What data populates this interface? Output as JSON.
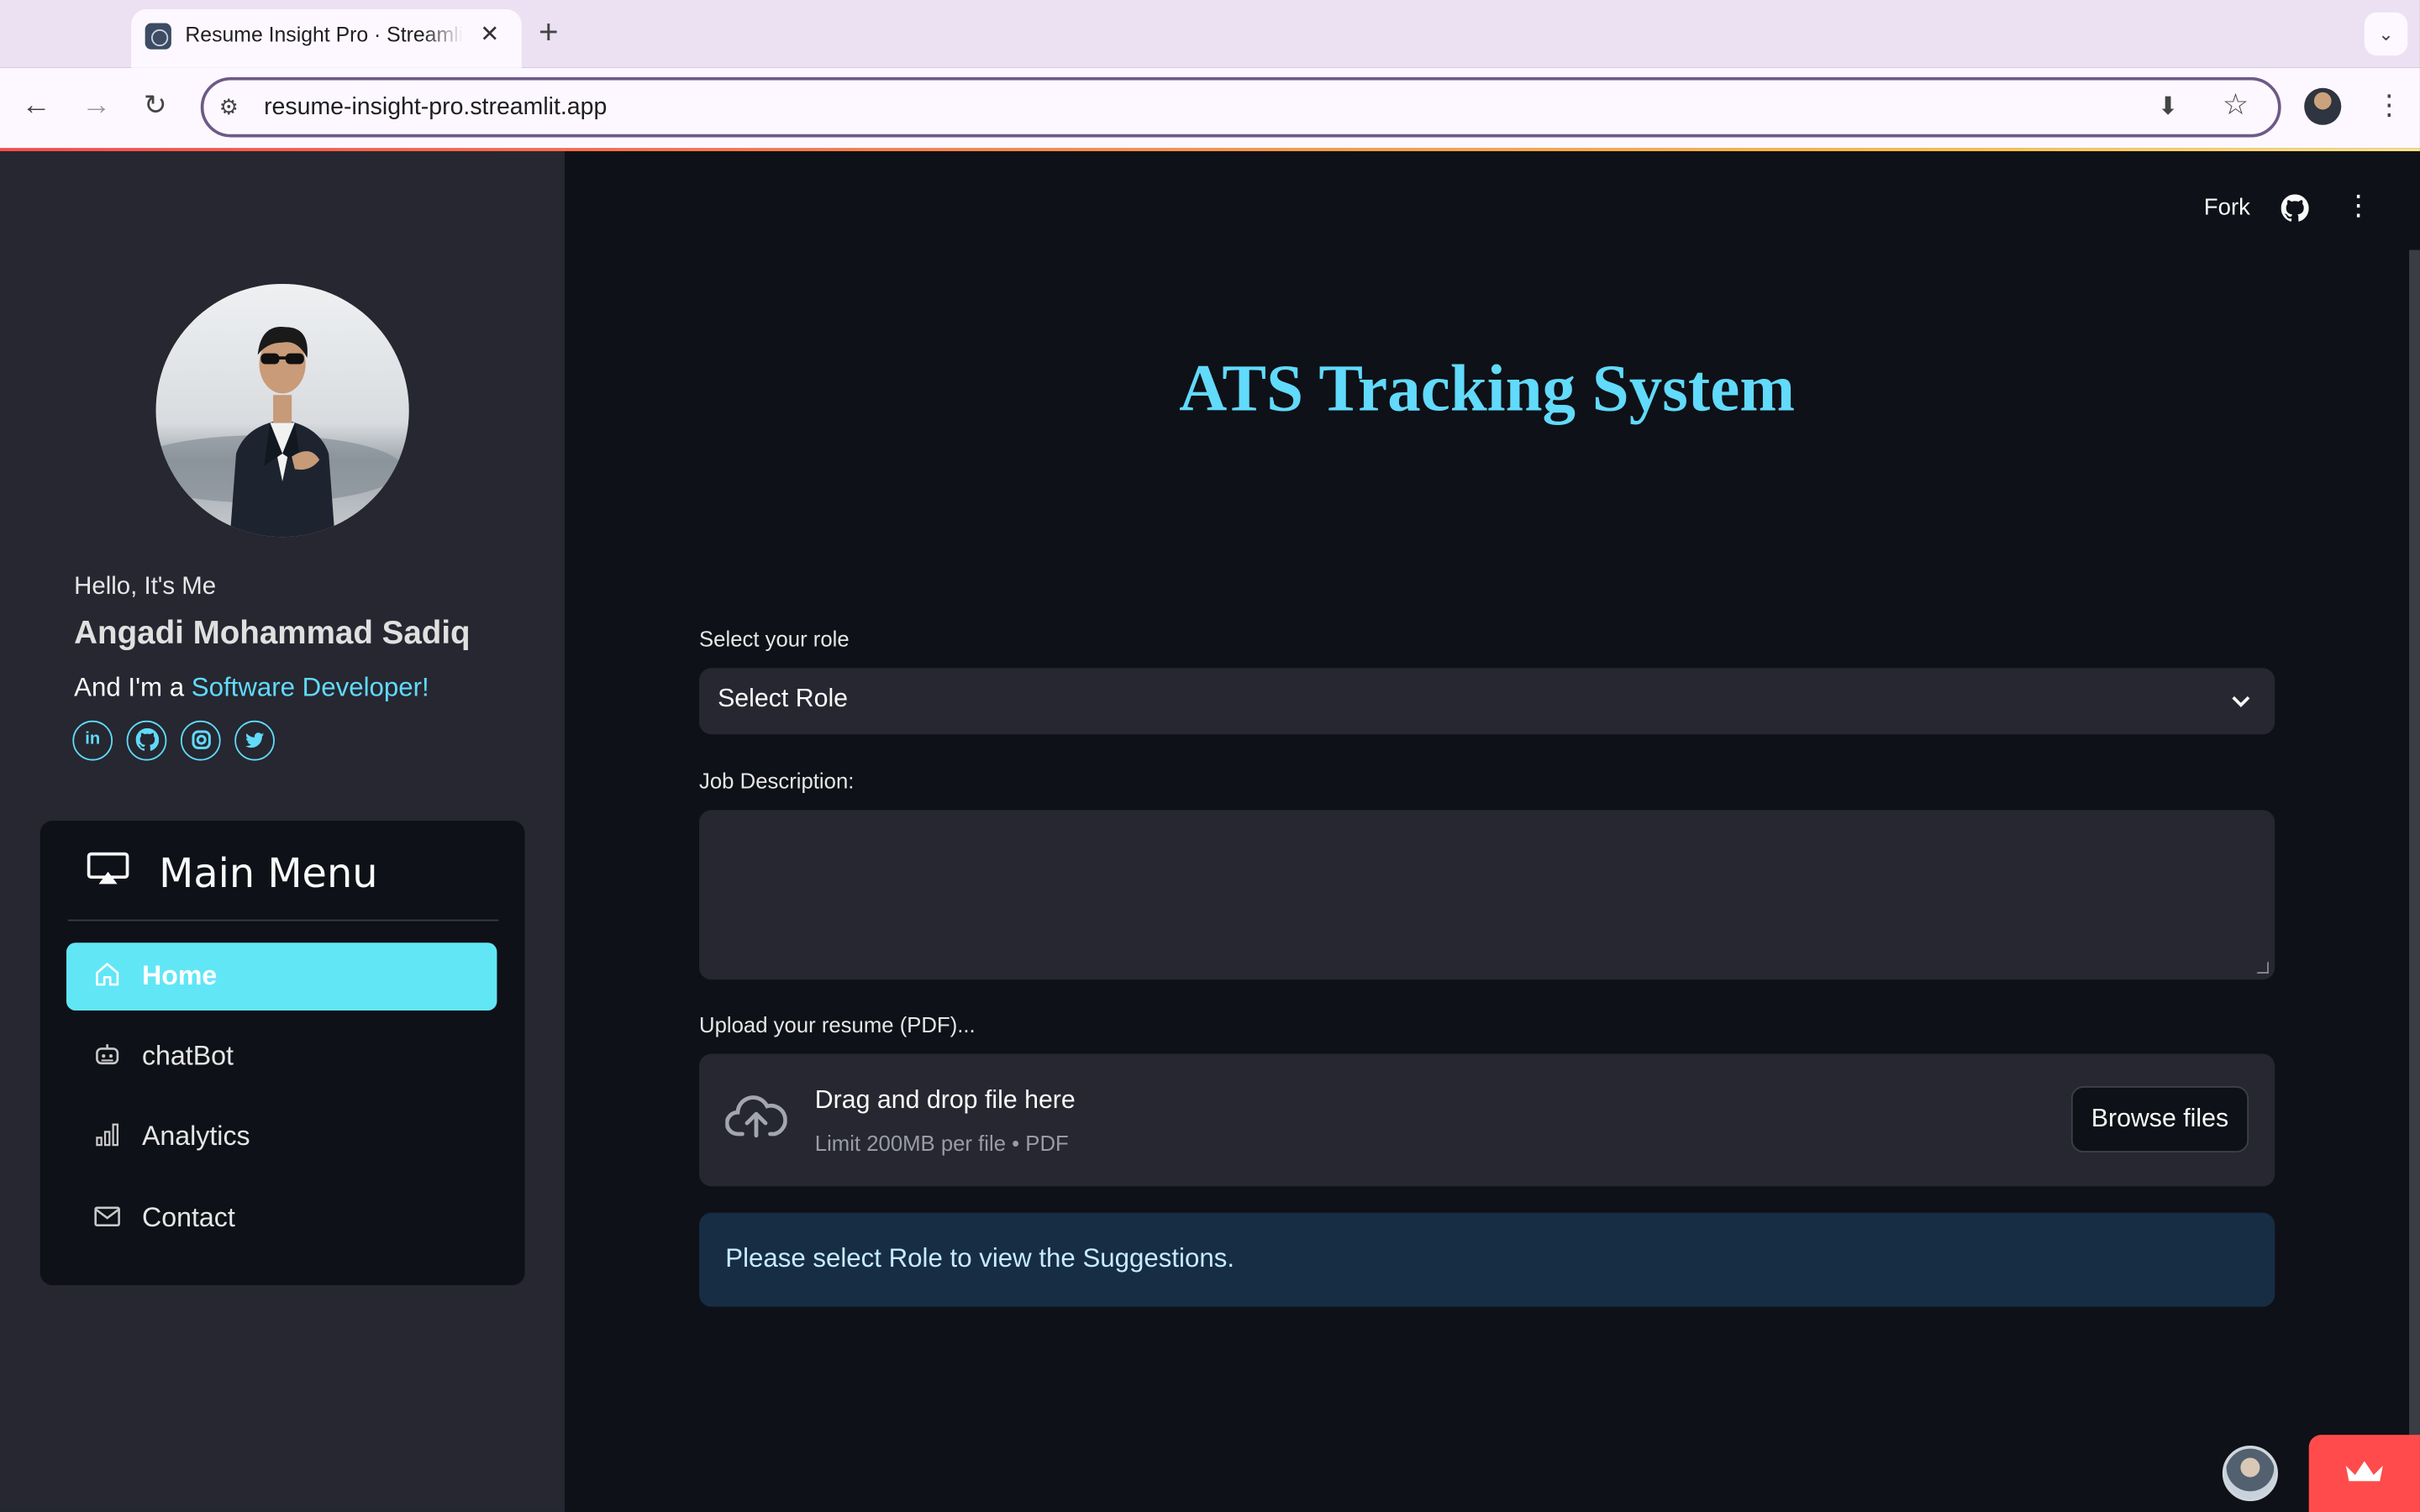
{
  "browser": {
    "tab_title": "Resume Insight Pro · Streamlit",
    "url": "resume-insight-pro.streamlit.app",
    "new_tab_glyph": "+",
    "close_glyph": "✕"
  },
  "sidebar": {
    "greeting": "Hello, It's Me",
    "name": "Angadi Mohammad Sadiq",
    "intro_prefix": "And I'm a ",
    "intro_role": "Software Developer!",
    "socials": [
      "linkedin-icon",
      "github-icon",
      "instagram-icon",
      "twitter-icon"
    ],
    "menu": {
      "title": "Main Menu",
      "items": [
        {
          "label": "Home",
          "icon": "house-icon",
          "active": true
        },
        {
          "label": "chatBot",
          "icon": "robot-icon",
          "active": false
        },
        {
          "label": "Analytics",
          "icon": "bar-chart-icon",
          "active": false
        },
        {
          "label": "Contact",
          "icon": "envelope-icon",
          "active": false
        }
      ]
    }
  },
  "header": {
    "fork_label": "Fork"
  },
  "main": {
    "title": "ATS Tracking System",
    "role_label": "Select your role",
    "role_value": "Select Role",
    "jd_label": "Job Description:",
    "jd_value": "",
    "upload_label": "Upload your resume (PDF)...",
    "upload_title": "Drag and drop file here",
    "upload_hint": "Limit 200MB per file • PDF",
    "browse_label": "Browse files",
    "info_message": "Please select Role to view the Suggestions."
  },
  "colors": {
    "accent": "#61dafb",
    "active_menu": "#61e6f6",
    "background": "#0e1117",
    "sidebar": "#262730",
    "info_bg": "#172d43"
  }
}
